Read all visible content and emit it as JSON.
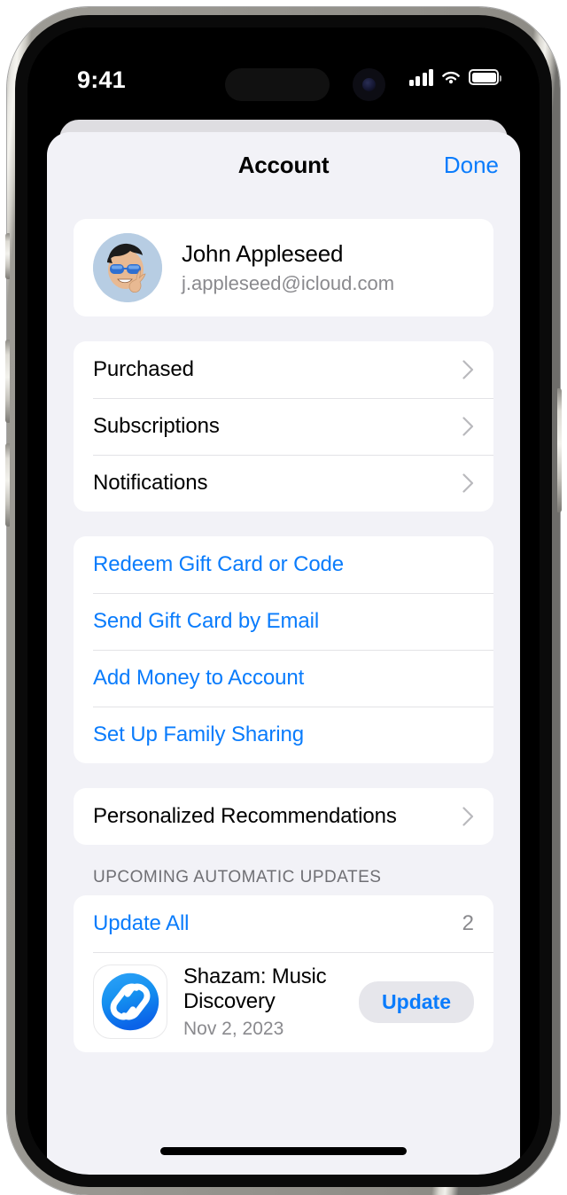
{
  "status_bar": {
    "time": "9:41",
    "cellular_icon": "signal-bars-icon",
    "wifi_icon": "wifi-icon",
    "battery_icon": "battery-full-icon"
  },
  "nav": {
    "title": "Account",
    "done_label": "Done"
  },
  "profile": {
    "name": "John Appleseed",
    "email": "j.appleseed@icloud.com",
    "avatar_icon": "memoji-avatar"
  },
  "groups": [
    {
      "items": [
        {
          "label": "Purchased",
          "accessory": "chevron-right-icon"
        },
        {
          "label": "Subscriptions",
          "accessory": "chevron-right-icon"
        },
        {
          "label": "Notifications",
          "accessory": "chevron-right-icon"
        }
      ]
    },
    {
      "items": [
        {
          "label": "Redeem Gift Card or Code"
        },
        {
          "label": "Send Gift Card by Email"
        },
        {
          "label": "Add Money to Account"
        },
        {
          "label": "Set Up Family Sharing"
        }
      ]
    },
    {
      "items": [
        {
          "label": "Personalized Recommendations",
          "accessory": "chevron-right-icon"
        }
      ]
    }
  ],
  "updates_section": {
    "header": "UPCOMING AUTOMATIC UPDATES",
    "update_all_label": "Update All",
    "update_all_count": "2",
    "apps": [
      {
        "name": "Shazam: Music Discovery",
        "date": "Nov 2, 2023",
        "button_label": "Update",
        "icon": "shazam-app-icon"
      }
    ]
  },
  "colors": {
    "accent_blue": "#0a7cfc",
    "sheet_background": "#f2f2f7",
    "card_background": "#ffffff",
    "secondary_text": "#8a8a8e"
  }
}
